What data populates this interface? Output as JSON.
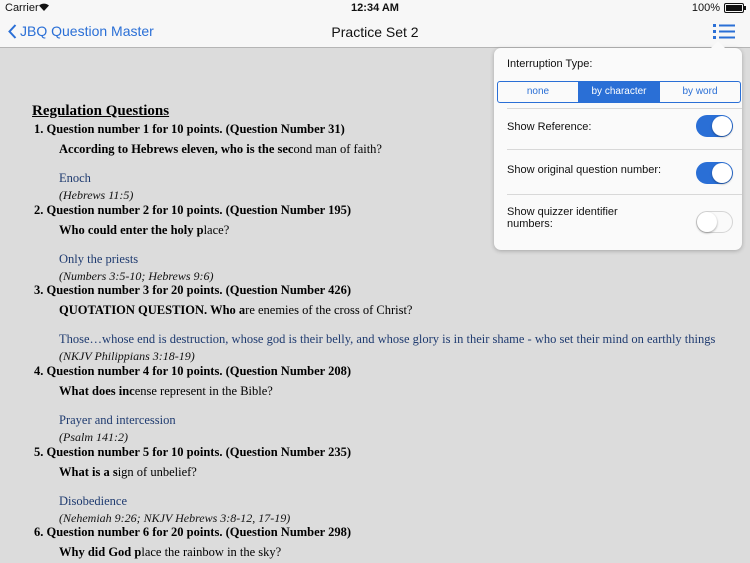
{
  "status_bar": {
    "carrier": "Carrier",
    "time": "12:34 AM",
    "battery": "100%"
  },
  "nav": {
    "back_label": "JBQ Question Master",
    "title": "Practice Set 2"
  },
  "section_title": "Regulation Questions",
  "questions": [
    {
      "header": "1. Question number 1 for 10 points. (Question Number 31)",
      "bold": "According to Hebrews eleven, who is the sec",
      "rest": "ond man of faith?",
      "answer": "Enoch",
      "reference": "(Hebrews 11:5)"
    },
    {
      "header": "2. Question number 2 for 10 points. (Question Number 195)",
      "bold": "Who could enter the holy p",
      "rest": "lace?",
      "answer": "Only the priests",
      "reference": "(Numbers 3:5-10; Hebrews 9:6)"
    },
    {
      "header": "3. Question number 3 for 20 points. (Question Number 426)",
      "bold": "QUOTATION QUESTION. Who a",
      "rest": "re enemies of the cross of Christ?",
      "answer": "Those…whose end is destruction, whose god is their belly, and whose glory is in their shame - who set their mind on earthly things",
      "reference": "(NKJV Philippians 3:18-19)"
    },
    {
      "header": "4. Question number 4 for 10 points. (Question Number 208)",
      "bold": "What does inc",
      "rest": "ense represent in the Bible?",
      "answer": "Prayer and intercession",
      "reference": "(Psalm 141:2)"
    },
    {
      "header": "5. Question number 5 for 10 points. (Question Number 235)",
      "bold": "What is a s",
      "rest": "ign of unbelief?",
      "answer": "Disobedience",
      "reference": "(Nehemiah 9:26; NKJV Hebrews 3:8-12, 17-19)"
    },
    {
      "header": "6. Question number 6 for 20 points. (Question Number 298)",
      "bold": "Why did God p",
      "rest": "lace the rainbow in the sky?",
      "answer": "",
      "reference": ""
    }
  ],
  "popover": {
    "interruption_label": "Interruption Type:",
    "segments": [
      "none",
      "by character",
      "by word"
    ],
    "selected_segment": "by character",
    "show_reference_label": "Show Reference:",
    "show_reference": true,
    "show_original_label": "Show original question number:",
    "show_original": true,
    "show_quizzer_label": "Show quizzer identifier numbers:",
    "show_quizzer": false
  },
  "colors": {
    "accent": "#2a6fd6",
    "answer": "#1f3b70",
    "background": "#dcdcdc"
  }
}
